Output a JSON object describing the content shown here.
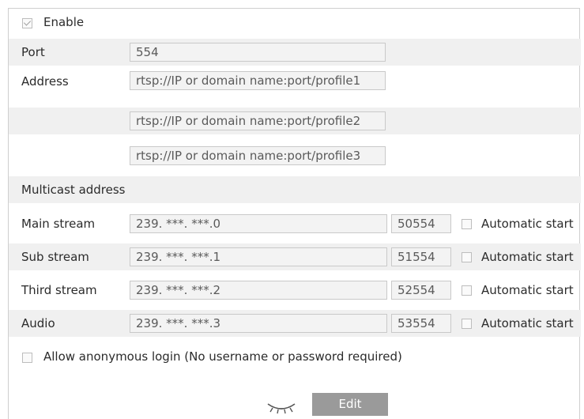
{
  "enable": {
    "label": "Enable",
    "checked": true
  },
  "port": {
    "label": "Port",
    "value": "554"
  },
  "address": {
    "label": "Address",
    "values": [
      "rtsp://IP or domain name:port/profile1",
      "rtsp://IP or domain name:port/profile2",
      "rtsp://IP or domain name:port/profile3"
    ]
  },
  "multicast": {
    "header": "Multicast address"
  },
  "streams": [
    {
      "label": "Main stream",
      "ip": "239. ***. ***.0",
      "port": "50554",
      "auto_label": "Automatic start"
    },
    {
      "label": "Sub stream",
      "ip": "239. ***. ***.1",
      "port": "51554",
      "auto_label": "Automatic start"
    },
    {
      "label": "Third stream",
      "ip": "239. ***. ***.2",
      "port": "52554",
      "auto_label": "Automatic start"
    },
    {
      "label": "Audio",
      "ip": "239. ***. ***.3",
      "port": "53554",
      "auto_label": "Automatic start"
    }
  ],
  "anonymous": {
    "label": "Allow anonymous login (No username or password required)",
    "checked": false
  },
  "actions": {
    "edit_label": "Edit"
  },
  "icons": {
    "password_toggle": "eye-closed-icon"
  }
}
